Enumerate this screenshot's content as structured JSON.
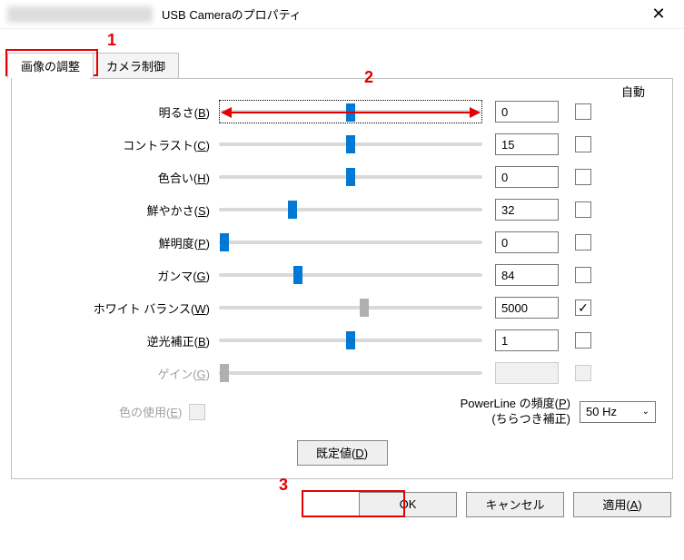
{
  "window": {
    "title": "USB Cameraのプロパティ",
    "close_glyph": "✕"
  },
  "tabs": {
    "active": "画像の調整",
    "inactive": "カメラ制御"
  },
  "auto_header": "自動",
  "sliders": [
    {
      "label": "明るさ(B)",
      "hotkey": "B",
      "value": "0",
      "pos": 50,
      "auto": false,
      "disabled": false,
      "highlighted": true
    },
    {
      "label": "コントラスト(C)",
      "hotkey": "C",
      "value": "15",
      "pos": 50,
      "auto": false,
      "disabled": false
    },
    {
      "label": "色合い(H)",
      "hotkey": "H",
      "value": "0",
      "pos": 50,
      "auto": false,
      "disabled": false
    },
    {
      "label": "鮮やかさ(S)",
      "hotkey": "S",
      "value": "32",
      "pos": 28,
      "auto": false,
      "disabled": false
    },
    {
      "label": "鮮明度(P)",
      "hotkey": "P",
      "value": "0",
      "pos": 2,
      "auto": false,
      "disabled": false
    },
    {
      "label": "ガンマ(G)",
      "hotkey": "G",
      "value": "84",
      "pos": 30,
      "auto": false,
      "disabled": false
    },
    {
      "label": "ホワイト バランス(W)",
      "hotkey": "W",
      "value": "5000",
      "pos": 55,
      "auto": true,
      "disabled": false,
      "gray_thumb": true
    },
    {
      "label": "逆光補正(B)",
      "hotkey": "B",
      "value": "1",
      "pos": 50,
      "auto": false,
      "disabled": false
    },
    {
      "label": "ゲイン(G)",
      "hotkey": "G",
      "value": "",
      "pos": 2,
      "auto": false,
      "disabled": true,
      "gray_thumb": true
    }
  ],
  "color_enable": {
    "label": "色の使用(E)",
    "hotkey": "E"
  },
  "powerline": {
    "label_top": "PowerLine の頻度(P)",
    "label_bottom": "(ちらつき補正)",
    "value": "50 Hz"
  },
  "buttons": {
    "default": "既定値(D)",
    "ok": "OK",
    "cancel": "キャンセル",
    "apply": "適用(A)"
  },
  "annotations": {
    "a1": "1",
    "a2": "2",
    "a3": "3"
  }
}
